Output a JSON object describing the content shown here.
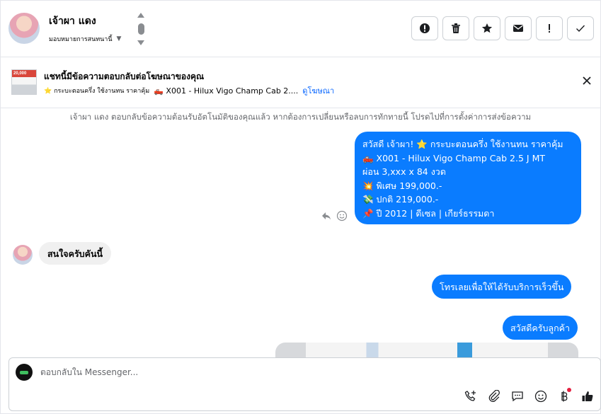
{
  "header": {
    "contact_name": "เจ้าผา แดง",
    "assign_label": "มอบหมายการสนทนานี้",
    "actions": [
      {
        "name": "report-icon",
        "label": "!"
      },
      {
        "name": "trash-icon",
        "label": ""
      },
      {
        "name": "star-icon",
        "label": ""
      },
      {
        "name": "mail-icon",
        "label": ""
      },
      {
        "name": "important-icon",
        "label": "!"
      },
      {
        "name": "check-icon",
        "label": ""
      }
    ]
  },
  "ad_banner": {
    "title": "แชทนี้มีข้อความตอบกลับต่อโฆษณาของคุณ",
    "thumb_text": "20,000",
    "desc_prefix": "⭐ กระบะตอนครึ่ง ใช้งานทน ราคาคุ้ม",
    "desc_main": "🛻 X001 - Hilux Vigo Champ Cab 2....",
    "link": "ดูโฆษณา"
  },
  "chat": {
    "system_note": "เจ้าผา แดง ตอบกลับข้อความต้อนรับอัตโนมัติของคุณแล้ว หากต้องการเปลี่ยนหรือลบการทักทายนี้ โปรดไปที่การตั้งค่าการส่งข้อความ",
    "big_message_lines": [
      "สวัสดี เจ้าผา! ⭐ กระบะตอนครึ่ง ใช้งานทน ราคาคุ้ม",
      "🛻 X001 - Hilux Vigo Champ Cab 2.5 J MT",
      "ผ่อน 3,xxx x 84 งวด",
      "💥 พิเศษ 199,000.-",
      "💸 ปกติ 219,000.-",
      "📌 ปี 2012 | ดีเซล | เกียร์ธรรมดา"
    ],
    "incoming_message": "สนใจครับคันนี้",
    "outgoing_2": "โทรเลยเพื่อให้ได้รับบริการเร็วขึ้น",
    "outgoing_3": "สวัสดีครับลูกค้า"
  },
  "composer": {
    "placeholder": "ตอบกลับใน Messenger..."
  },
  "colors": {
    "bubble_out": "#0a7cff",
    "bubble_in": "#f0f0f0",
    "link": "#0866ff"
  }
}
